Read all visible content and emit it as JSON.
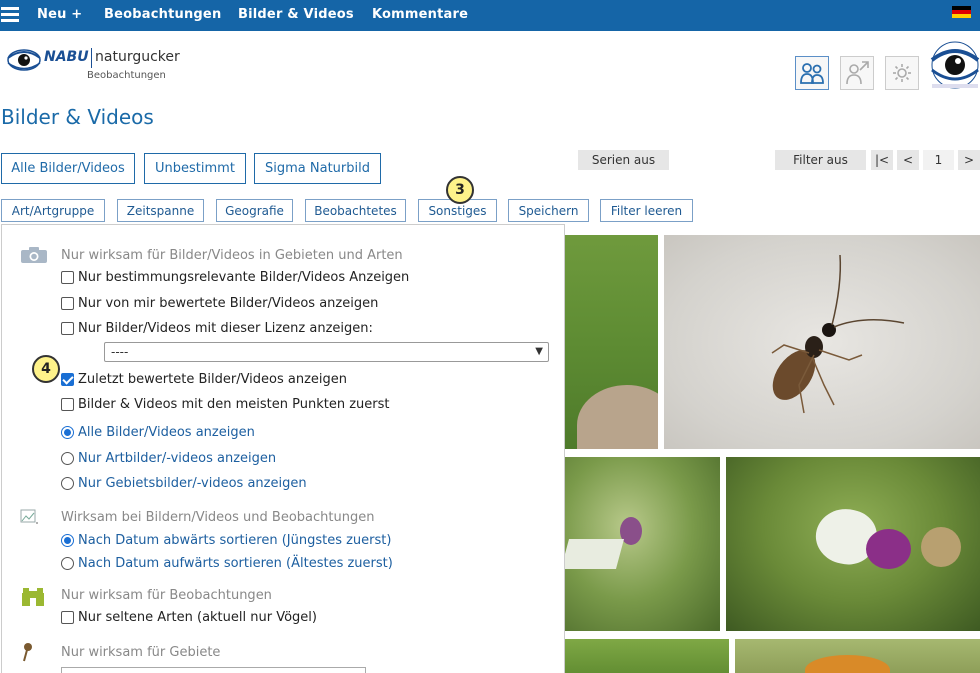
{
  "nav": {
    "new_label": "Neu +",
    "links": [
      "Beobachtungen",
      "Bilder & Videos",
      "Kommentare"
    ]
  },
  "header": {
    "logo_brand": "NABU",
    "logo_name": "naturgucker",
    "logo_sub": "Beobachtungen"
  },
  "page_title": "Bilder & Videos",
  "top_buttons": {
    "all": "Alle Bilder/Videos",
    "undetermined": "Unbestimmt",
    "sigma": "Sigma Naturbild"
  },
  "series_label": "Serien aus",
  "filter_label": "Filter aus",
  "pagination": {
    "first": "|<",
    "prev": "<",
    "page": "1",
    "next": ">"
  },
  "filter_tabs": [
    "Art/Artgruppe",
    "Zeitspanne",
    "Geografie",
    "Beobachtetes",
    "Sonstiges",
    "Speichern",
    "Filter leeren"
  ],
  "badges": {
    "three": "3",
    "four": "4"
  },
  "panel": {
    "section1": {
      "heading": "Nur wirksam für Bilder/Videos in Gebieten und Arten",
      "checks": [
        {
          "label": "Nur bestimmungsrelevante Bilder/Videos Anzeigen",
          "checked": false
        },
        {
          "label": "Nur von mir bewertete Bilder/Videos anzeigen",
          "checked": false
        },
        {
          "label": "Nur Bilder/Videos mit dieser Lizenz anzeigen:",
          "checked": false
        }
      ],
      "license_select": "----",
      "checks2": [
        {
          "label": "Zuletzt bewertete Bilder/Videos anzeigen",
          "checked": true
        },
        {
          "label": "Bilder & Videos mit den meisten Punkten zuerst",
          "checked": false
        }
      ],
      "radios": [
        {
          "label": "Alle Bilder/Videos anzeigen",
          "selected": true
        },
        {
          "label": "Nur Artbilder/-videos anzeigen",
          "selected": false
        },
        {
          "label": "Nur Gebietsbilder/-videos anzeigen",
          "selected": false
        }
      ]
    },
    "section2": {
      "heading": "Wirksam bei Bildern/Videos und Beobachtungen",
      "radios": [
        {
          "label": "Nach Datum abwärts sortieren (Jüngstes zuerst)",
          "selected": true
        },
        {
          "label": "Nach Datum aufwärts sortieren (Ältestes zuerst)",
          "selected": false
        }
      ]
    },
    "section3": {
      "heading": "Nur wirksam für Beobachtungen",
      "check": {
        "label": "Nur seltene Arten (aktuell nur Vögel)",
        "checked": false
      }
    },
    "section4": {
      "heading": "Nur wirksam für Gebiete"
    }
  },
  "colors": {
    "nav_bg": "#1565a7",
    "accent_blue": "#1f6aa8",
    "badge_yellow": "#fef28a"
  }
}
